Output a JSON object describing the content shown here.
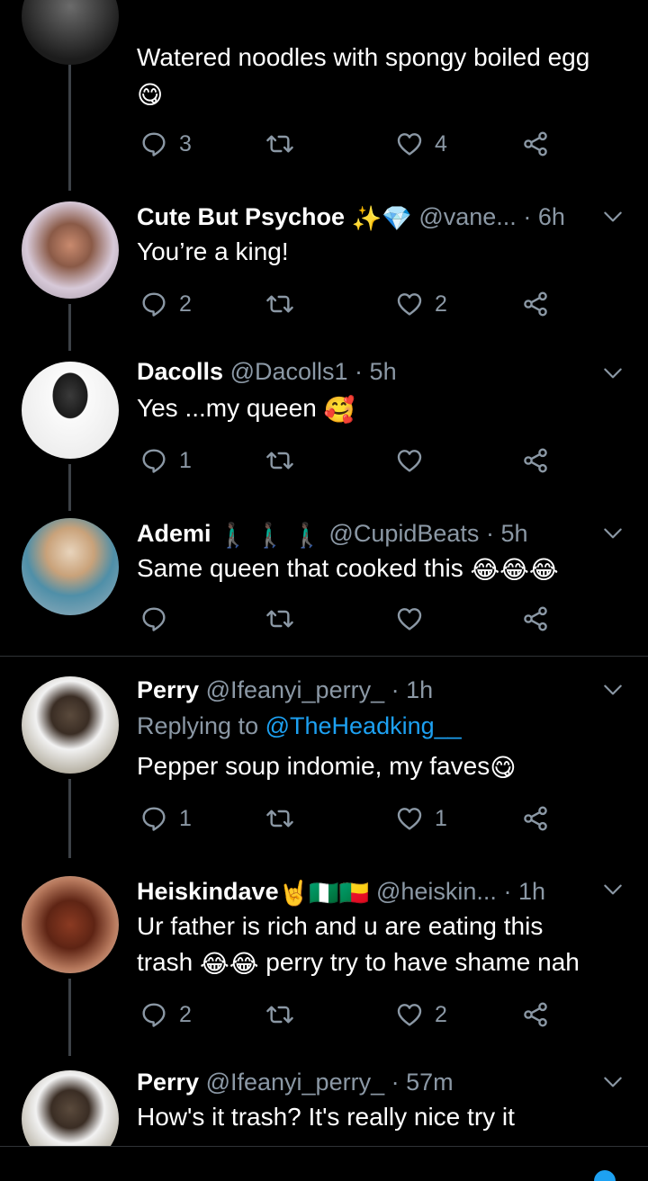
{
  "tweets": [
    {
      "text_line1": "Watered noodles with spongy boiled egg",
      "emoji": "😋",
      "replies": "3",
      "retweets": "",
      "likes": "4"
    },
    {
      "name": "Cute But Psychoe",
      "name_emoji": "✨💎",
      "handle": "@vane...",
      "dot": "·",
      "time": "6h",
      "text": "You’re a king!",
      "replies": "2",
      "retweets": "",
      "likes": "2"
    },
    {
      "name": "Dacolls",
      "handle": "@Dacolls1",
      "dot": "·",
      "time": "5h",
      "text": "Yes ...my queen",
      "emoji": "🥰",
      "replies": "1",
      "retweets": "",
      "likes": ""
    },
    {
      "name": "Ademi",
      "name_emoji": "🚶🏿‍♂️ 🚶🏿‍♂️ 🚶🏿‍♂️",
      "handle": "@CupidBeats",
      "dot": "·",
      "time": "5h",
      "text": "Same queen that cooked this",
      "emoji": "😂😂😂",
      "replies": "",
      "retweets": "",
      "likes": ""
    },
    {
      "name": "Perry",
      "handle": "@Ifeanyi_perry_",
      "dot": "·",
      "time": "1h",
      "replying_prefix": "Replying to",
      "replying_to": "@TheHeadking__",
      "text": "Pepper soup indomie, my faves",
      "emoji": "😋",
      "replies": "1",
      "retweets": "",
      "likes": "1"
    },
    {
      "name": "Heiskindave",
      "name_emoji": "🤘🇳🇬🇧🇯",
      "handle": "@heiskin...",
      "dot": "·",
      "time": "1h",
      "text_line1": "Ur father is rich and u are eating this",
      "text_line2_a": "trash",
      "emoji": "😂😂",
      "text_line2_b": "perry try to have shame nah",
      "replies": "2",
      "retweets": "",
      "likes": "2"
    },
    {
      "name": "Perry",
      "handle": "@Ifeanyi_perry_",
      "dot": "·",
      "time": "57m",
      "text": "How's it trash? It's really nice try it"
    }
  ],
  "colors": {
    "background": "#000000",
    "secondary_text": "#8b98a5",
    "link": "#1da1f2",
    "divider": "#2f3336"
  },
  "icons": [
    "reply-icon",
    "retweet-icon",
    "like-icon",
    "share-icon",
    "chevron-down-icon"
  ]
}
